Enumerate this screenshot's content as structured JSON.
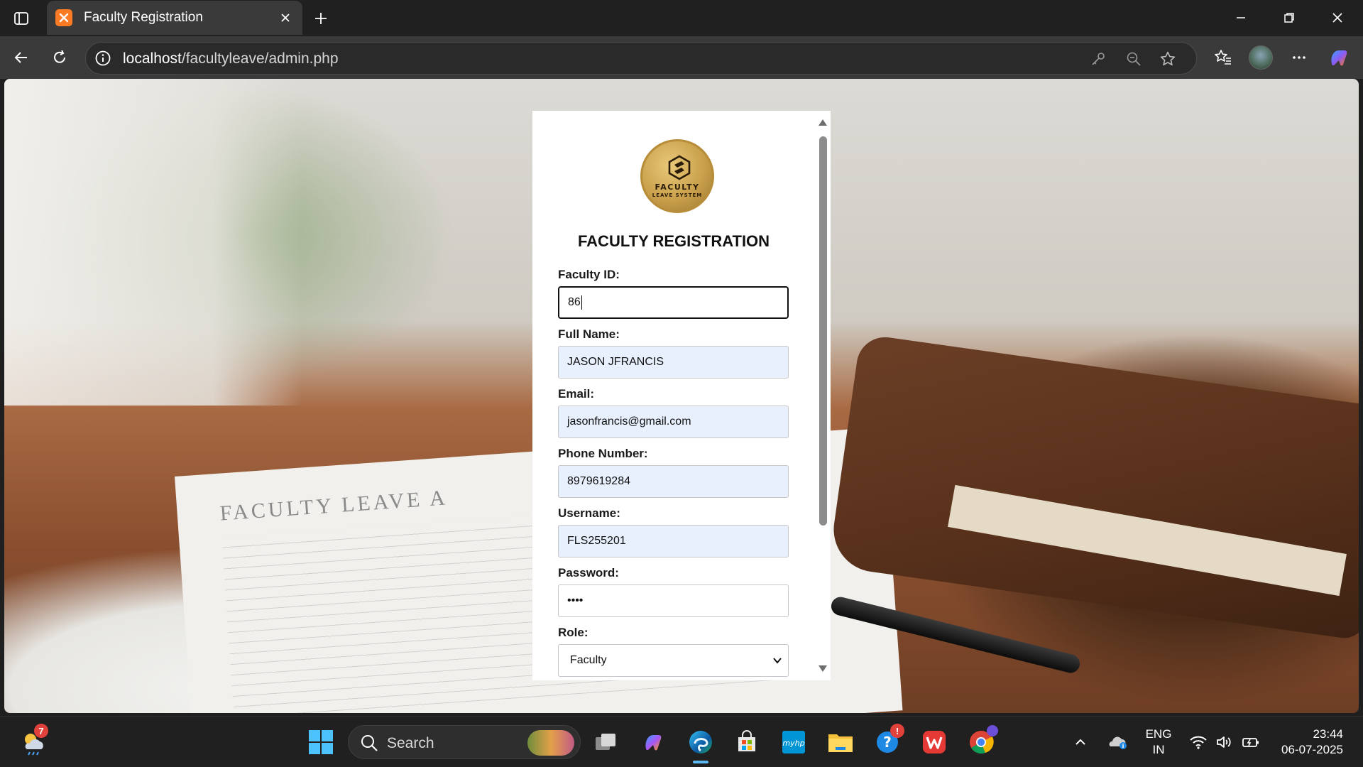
{
  "browser": {
    "tab_title": "Faculty Registration",
    "url_host": "localhost",
    "url_path": "/facultyleave/admin.php"
  },
  "background": {
    "paper_heading": "FACULTY LEAVE A"
  },
  "form": {
    "logo_line1": "FACULTY",
    "logo_line2": "LEAVE SYSTEM",
    "title": "FACULTY REGISTRATION",
    "faculty_id": {
      "label": "Faculty ID:",
      "value": "86"
    },
    "full_name": {
      "label": "Full Name:",
      "value": "JASON JFRANCIS"
    },
    "email": {
      "label": "Email:",
      "value": "jasonfrancis@gmail.com"
    },
    "phone": {
      "label": "Phone Number:",
      "value": "8979619284"
    },
    "username": {
      "label": "Username:",
      "value": "FLS255201"
    },
    "password": {
      "label": "Password:",
      "value": "••••"
    },
    "role": {
      "label": "Role:",
      "value": "Faculty"
    }
  },
  "taskbar": {
    "weather_badge": "7",
    "search_label": "Search",
    "help_badge": "!",
    "lang_line1": "ENG",
    "lang_line2": "IN",
    "time": "23:44",
    "date": "06-07-2025"
  },
  "colors": {
    "accent": "#5cb8f0",
    "autofill": "#e8f0fe",
    "logo_gold": "#c9a04b"
  }
}
